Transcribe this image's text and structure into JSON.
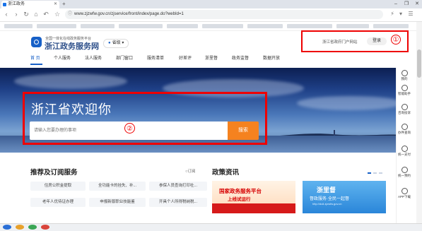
{
  "browser": {
    "tab_title": "浙江政务",
    "url": "www.zjzwfw.gov.cn/zjservice/front/index/page.do?webId=1"
  },
  "header": {
    "logo_subtitle": "全国一体化在线政务服务平台",
    "logo_title": "浙江政务服务网",
    "region": "省级",
    "portal_link": "浙江省政府门户网站",
    "login_label": "登录",
    "annotation_1": "①"
  },
  "nav": {
    "items": [
      "首 页",
      "个人服务",
      "法人服务",
      "部门窗口",
      "服务清单",
      "好差评",
      "浙里督",
      "政务监督",
      "数据开放"
    ]
  },
  "hero": {
    "title": "浙江省欢迎你",
    "search_placeholder": "请输入您要办理的事项",
    "search_button": "搜索",
    "annotation_2": "②"
  },
  "rail": {
    "items": [
      "我的",
      "智能助手",
      "咨询投诉",
      "办件查询",
      "统一支付",
      "统一预约",
      "APP下载"
    ]
  },
  "recommend": {
    "title": "推荐及订阅服务",
    "subscribe": "订阅",
    "services": [
      [
        "住房公积金提取",
        "全功能卡的挂失、补...",
        "参保人员查询打印社..."
      ],
      [
        "老年人优待证办理",
        "申报新版职业技能鉴",
        "开具个人所得税纳税..."
      ]
    ]
  },
  "news": {
    "title": "政策资讯",
    "banner1_line1": "国家政务服务平台",
    "banner1_line2": "上线试运行",
    "banner2_line1": "浙里督",
    "banner2_line2": "督政服务·全民一起督",
    "banner2_line3": "http://duli.zjzwfw.gov.cn"
  }
}
